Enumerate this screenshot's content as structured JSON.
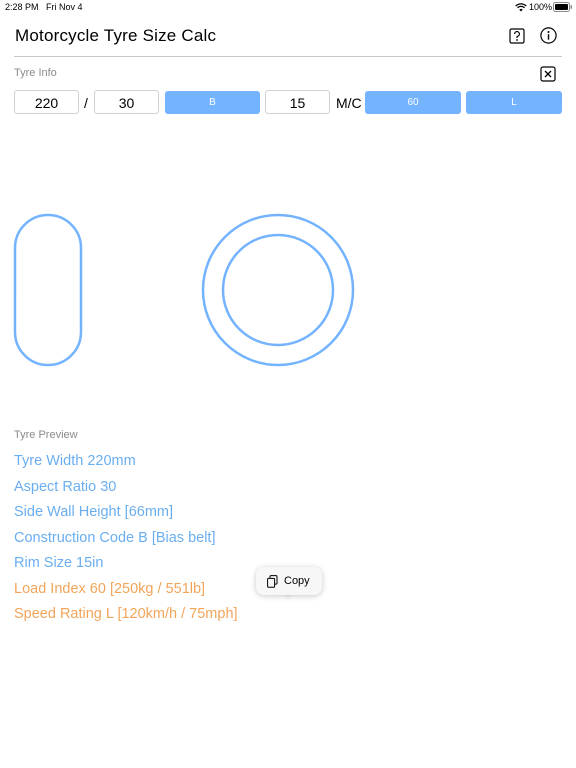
{
  "status_bar": {
    "time": "2:28 PM",
    "date": "Fri Nov 4",
    "battery": "100%"
  },
  "header": {
    "title": "Motorcycle Tyre Size Calc",
    "help_icon": "question-mark-icon",
    "info_icon": "info-circle-icon"
  },
  "tyre_info": {
    "label": "Tyre Info",
    "width": "220",
    "separator": "/",
    "aspect": "30",
    "construction": "B",
    "rim": "15",
    "mc_label": "M/C",
    "load_index": "60",
    "speed_rating": "L"
  },
  "preview": {
    "label": "Tyre Preview",
    "lines": [
      "Tyre Width 220mm",
      "Aspect Ratio 30",
      "Side Wall Height [66mm]",
      "Construction Code B [Bias belt]",
      "Rim Size 15in",
      "Load Index 60 [250kg / 551lb]",
      "Speed Rating L [120km/h / 75mph]"
    ]
  },
  "copy_popup": {
    "label": "Copy"
  },
  "colors": {
    "accent": "#74b3ff",
    "preview_blue": "#6aaef0",
    "preview_orange": "#f2a55a"
  }
}
